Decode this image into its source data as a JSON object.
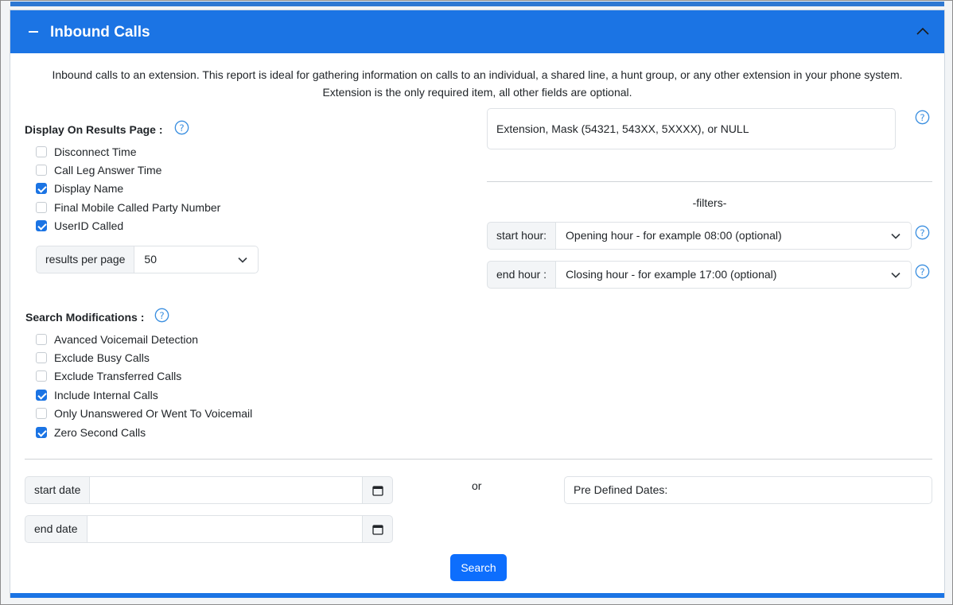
{
  "header": {
    "title": "Inbound Calls"
  },
  "intro": {
    "line1": "Inbound calls to an extension. This report is ideal for gathering information on calls to an individual, a shared line, a hunt group, or any other extension in your phone system.",
    "line2": "Extension is the only required item, all other fields are optional."
  },
  "display_section": {
    "title": "Display On Results Page :",
    "options": [
      {
        "label": "Disconnect Time",
        "checked": false
      },
      {
        "label": "Call Leg Answer Time",
        "checked": false
      },
      {
        "label": "Display Name",
        "checked": true
      },
      {
        "label": "Final Mobile Called Party Number",
        "checked": false
      },
      {
        "label": "UserID Called",
        "checked": true
      }
    ],
    "results_per_page": {
      "label": "results per page",
      "value": "50"
    }
  },
  "search_mods": {
    "title": "Search Modifications :",
    "options": [
      {
        "label": "Avanced Voicemail Detection",
        "checked": false
      },
      {
        "label": "Exclude Busy Calls",
        "checked": false
      },
      {
        "label": "Exclude Transferred Calls",
        "checked": false
      },
      {
        "label": "Include Internal Calls",
        "checked": true
      },
      {
        "label": "Only Unanswered Or Went To Voicemail",
        "checked": false
      },
      {
        "label": "Zero Second Calls",
        "checked": true
      }
    ]
  },
  "extension": {
    "placeholder": "Extension, Mask (54321, 543XX, 5XXXX), or NULL"
  },
  "filters": {
    "label": "-filters-",
    "start_hour": {
      "label": "start hour:",
      "value": "Opening hour - for example 08:00 (optional)"
    },
    "end_hour": {
      "label": "end hour :",
      "value": "Closing hour - for example 17:00 (optional)"
    }
  },
  "dates": {
    "start_label": "start date",
    "end_label": "end date",
    "or_label": "or",
    "predefined_placeholder": "Pre Defined Dates:"
  },
  "search_button": "Search",
  "colors": {
    "primary": "#1b74e4",
    "button": "#0d6efd",
    "help": "#3b8fe0"
  }
}
